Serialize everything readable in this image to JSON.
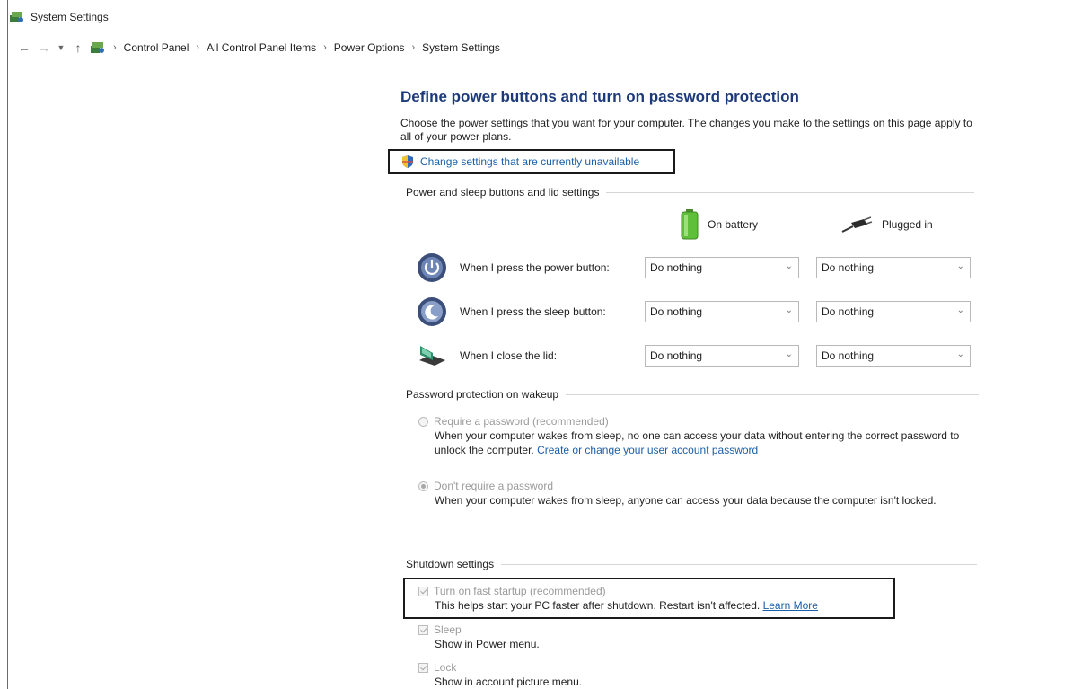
{
  "window": {
    "title": "System Settings"
  },
  "breadcrumb": [
    "Control Panel",
    "All Control Panel Items",
    "Power Options",
    "System Settings"
  ],
  "main": {
    "title": "Define power buttons and turn on password protection",
    "description": "Choose the power settings that you want for your computer. The changes you make to the settings on this page apply to all of your power plans.",
    "change_link": "Change settings that are currently unavailable"
  },
  "power_section": {
    "header": "Power and sleep buttons and lid settings",
    "col_battery": "On battery",
    "col_plugged": "Plugged in",
    "rows": [
      {
        "label": "When I press the power button:",
        "battery": "Do nothing",
        "plugged": "Do nothing"
      },
      {
        "label": "When I press the sleep button:",
        "battery": "Do nothing",
        "plugged": "Do nothing"
      },
      {
        "label": "When I close the lid:",
        "battery": "Do nothing",
        "plugged": "Do nothing"
      }
    ]
  },
  "password_section": {
    "header": "Password protection on wakeup",
    "require": {
      "label": "Require a password (recommended)",
      "desc": "When your computer wakes from sleep, no one can access your data without entering the correct password to unlock the computer.",
      "link": "Create or change your user account password",
      "selected": false
    },
    "dont_require": {
      "label": "Don't require a password",
      "desc": "When your computer wakes from sleep, anyone can access your data because the computer isn't locked.",
      "selected": true
    }
  },
  "shutdown_section": {
    "header": "Shutdown settings",
    "fast_startup": {
      "label": "Turn on fast startup (recommended)",
      "desc": "This helps start your PC faster after shutdown. Restart isn't affected.",
      "link": "Learn More",
      "checked": true
    },
    "sleep": {
      "label": "Sleep",
      "desc": "Show in Power menu.",
      "checked": true
    },
    "lock": {
      "label": "Lock",
      "desc": "Show in account picture menu.",
      "checked": true
    }
  },
  "colors": {
    "title_blue": "#1c3a7a",
    "link_blue": "#1a5fa8",
    "highlight_border": "#1a1a1a"
  }
}
